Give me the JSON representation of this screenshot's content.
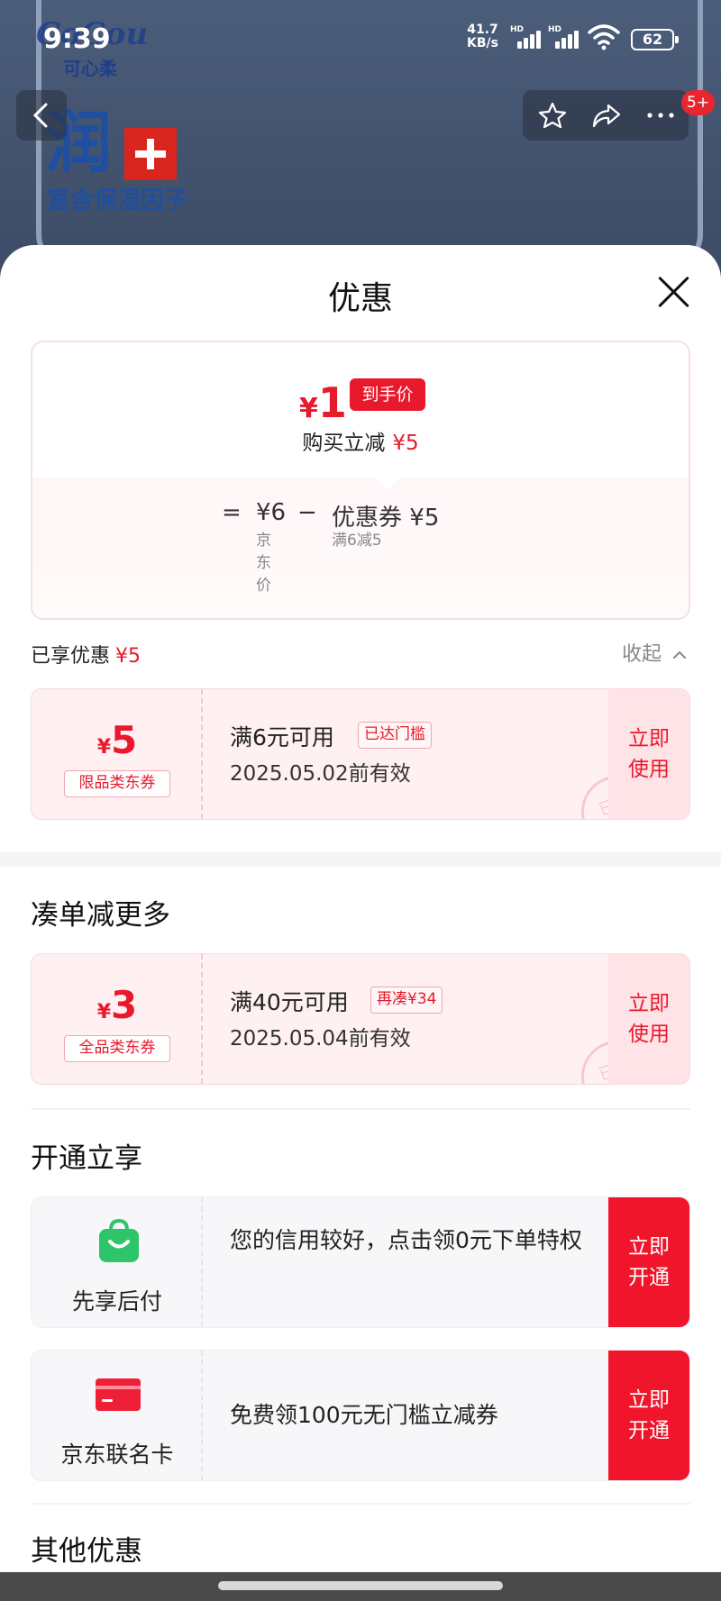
{
  "status_bar": {
    "time": "9:39",
    "net_speed_value": "41.7",
    "net_speed_unit": "KB/s",
    "hd_label": "HD",
    "battery": "62"
  },
  "background": {
    "brand_logo": "CoCou",
    "brand_name": "可心柔",
    "run_char": "润",
    "rich_text": "富含保湿因子"
  },
  "nav": {
    "back_icon": "chevron-left-icon",
    "star_icon": "star-icon",
    "share_icon": "share-icon",
    "more_icon": "more-icon",
    "badge": "5+"
  },
  "sheet": {
    "title": "优惠",
    "final_price_yen": "¥",
    "final_price_value": "1",
    "to_hand_tag": "到手价",
    "save_label": "购买立减",
    "save_value": "¥5",
    "formula": {
      "equals": "=",
      "jd_price": "¥6",
      "jd_price_label": [
        "京",
        "东",
        "价"
      ],
      "minus": "−",
      "coupon_label": "优惠券",
      "coupon_value": "¥5",
      "coupon_sub": "满6减5"
    },
    "enjoyed_label": "已享优惠",
    "enjoyed_value": "¥5",
    "collapse_label": "收起"
  },
  "coupons": [
    {
      "yen": "¥",
      "amount": "5",
      "type_tag": "限品类东券",
      "condition": "满6元可用",
      "status_tag": "已达门槛",
      "valid": "2025.05.02前有效",
      "use_button": [
        "立即",
        "使用"
      ],
      "stamp": "已领"
    },
    {
      "yen": "¥",
      "amount": "3",
      "type_tag": "全品类东券",
      "condition": "满40元可用",
      "status_tag": "再凑¥34",
      "valid": "2025.05.04前有效",
      "use_button": [
        "立即",
        "使用"
      ],
      "stamp": "已领"
    }
  ],
  "sections": {
    "more_savings": "凑单减更多",
    "open_enjoy": "开通立享",
    "other": "其他优惠"
  },
  "services": [
    {
      "icon": "shopping-bag-icon",
      "name": "先享后付",
      "desc": "您的信用较好，点击领0元下单特权",
      "button": [
        "立即",
        "开通"
      ]
    },
    {
      "icon": "credit-card-icon",
      "name": "京东联名卡",
      "desc": "免费领100元无门槛立减券",
      "button": [
        "立即",
        "开通"
      ]
    }
  ],
  "colors": {
    "accent_red": "#e8192c",
    "button_red": "#f0152a",
    "coupon_bg": "#fff0f2",
    "green_icon": "#2ec56a"
  }
}
